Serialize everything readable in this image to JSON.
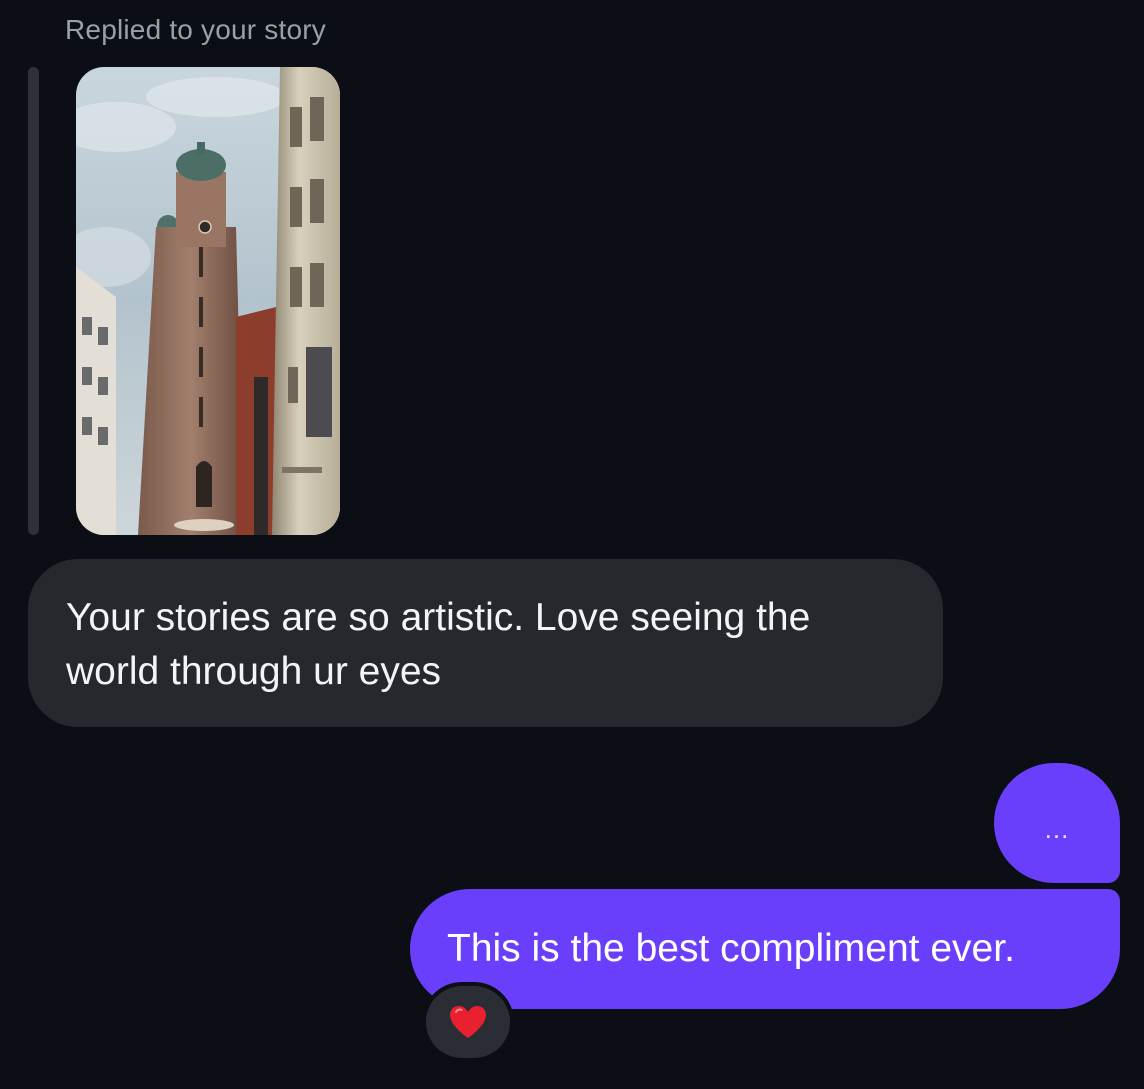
{
  "story_reply": {
    "label": "Replied to your story"
  },
  "messages": {
    "incoming_text": "Your stories are so artistic. Love seeing the world through ur eyes",
    "typing_indicator": "...",
    "outgoing_text": "This is the best compliment ever."
  },
  "reaction": {
    "icon": "heart-icon"
  },
  "colors": {
    "background": "#0b0e14",
    "incoming_bubble": "#25282d",
    "outgoing_bubble": "#6a3ffb",
    "heart": "#e8202f"
  }
}
